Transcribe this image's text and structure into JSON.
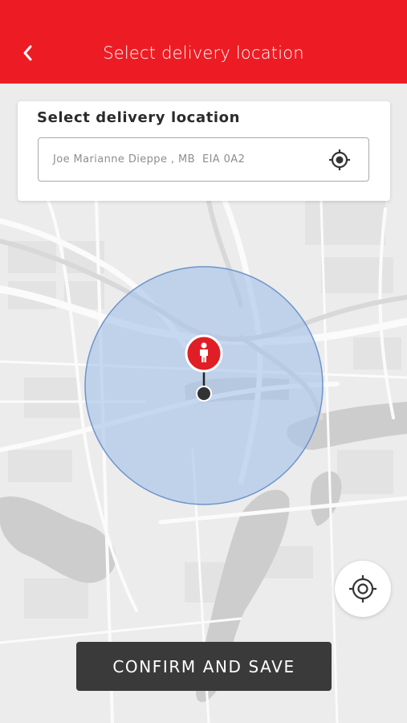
{
  "header": {
    "title": "Select delivery location",
    "back_icon": "chevron-left-icon",
    "background": "#ed1c24"
  },
  "location_card": {
    "title": "Select delivery location",
    "address_value": "Joe Marianne Dieppe , MB  EIA 0A2",
    "locate_icon": "crosshair-icon"
  },
  "map": {
    "radius_fill": "#a9c3ea",
    "radius_stroke": "#6c94cc",
    "pin_color": "#e01e26",
    "pin_icon": "person-icon"
  },
  "my_location_button": {
    "icon": "crosshair-icon"
  },
  "confirm_button": {
    "label": "CONFIRM AND SAVE",
    "background": "#3a3a3a"
  }
}
